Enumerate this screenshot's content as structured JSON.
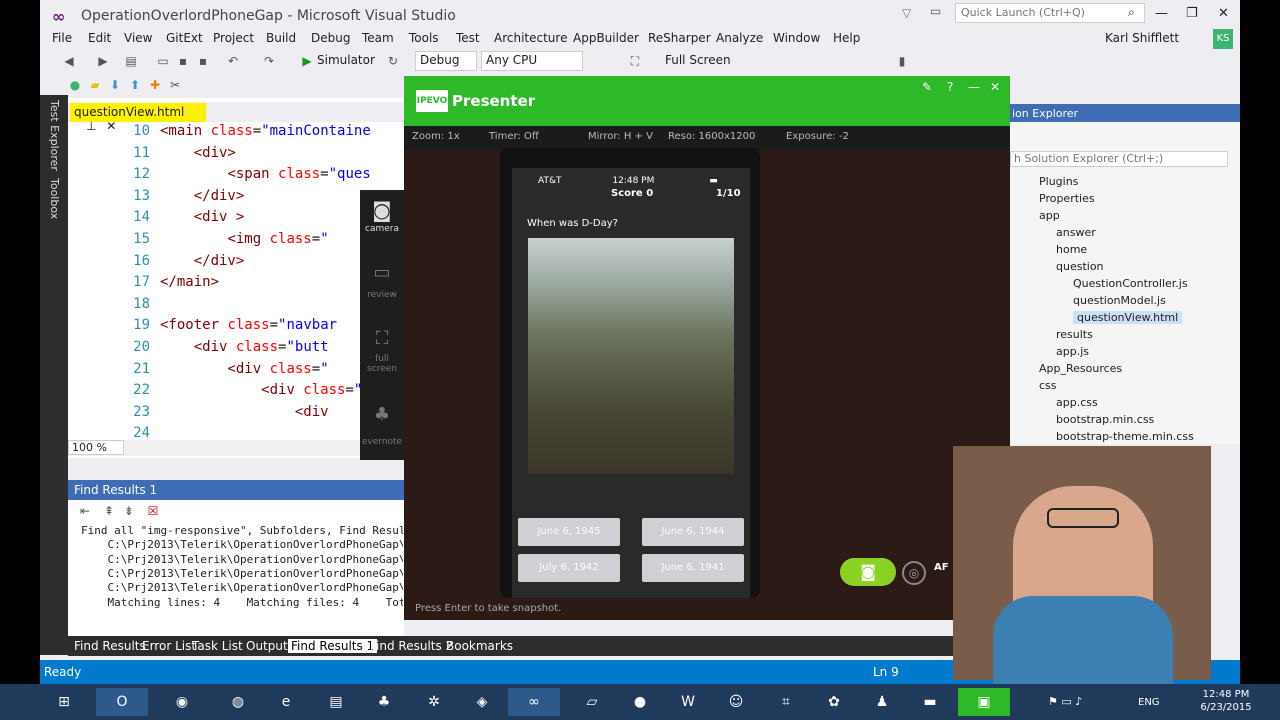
{
  "window": {
    "title": "OperationOverlordPhoneGap - Microsoft Visual Studio",
    "quick_launch": "Quick Launch (Ctrl+Q)",
    "user": "Karl Shifflett",
    "avatar": "KS"
  },
  "menu": [
    "File",
    "Edit",
    "View",
    "GitExt",
    "Project",
    "Build",
    "Debug",
    "Team",
    "Tools",
    "Test",
    "Architecture",
    "AppBuilder",
    "ReSharper",
    "Analyze",
    "Window",
    "Help"
  ],
  "toolbar": {
    "run_target": "Simulator",
    "config": "Debug",
    "platform": "Any CPU",
    "full_screen": "Full Screen"
  },
  "side_tabs": [
    "Test Explorer",
    "Toolbox"
  ],
  "editor": {
    "file_tab": "questionView.html",
    "zoom": "100 %",
    "lines": [
      {
        "n": "10",
        "html": "<span class='tag'>&lt;main</span> <span class='attr'>class</span>=<span class='str'>\"mainContaine</span>"
      },
      {
        "n": "11",
        "html": "    <span class='tag'>&lt;div&gt;</span>"
      },
      {
        "n": "12",
        "html": "        <span class='tag'>&lt;span</span> <span class='attr'>class</span>=<span class='str'>\"ques</span>"
      },
      {
        "n": "13",
        "html": "    <span class='tag'>&lt;/div&gt;</span>"
      },
      {
        "n": "14",
        "html": "    <span class='tag'>&lt;div</span> <span class='tag'>&gt;</span>"
      },
      {
        "n": "15",
        "html": "        <span class='tag'>&lt;img</span> <span class='attr'>class</span>=<span class='str'>\"</span>"
      },
      {
        "n": "16",
        "html": "    <span class='tag'>&lt;/div&gt;</span>"
      },
      {
        "n": "17",
        "html": "<span class='tag'>&lt;/main&gt;</span>"
      },
      {
        "n": "18",
        "html": ""
      },
      {
        "n": "19",
        "html": "<span class='tag'>&lt;footer</span> <span class='attr'>class</span>=<span class='str'>\"navbar</span>"
      },
      {
        "n": "20",
        "html": "    <span class='tag'>&lt;div</span> <span class='attr'>class</span>=<span class='str'>\"butt</span>"
      },
      {
        "n": "21",
        "html": "        <span class='tag'>&lt;div</span> <span class='attr'>class</span>=<span class='str'>\"</span>"
      },
      {
        "n": "22",
        "html": "            <span class='tag'>&lt;div</span> <span class='attr'>class</span>=<span class='str'>\"</span>"
      },
      {
        "n": "23",
        "html": "                <span class='tag'>&lt;div</span>"
      },
      {
        "n": "24",
        "html": ""
      }
    ]
  },
  "find_results": {
    "title": "Find Results 1",
    "lines": [
      "Find all \"img-responsive\", Subfolders, Find Resul",
      "    C:\\Prj2013\\Telerik\\OperationOverlordPhoneGap\\ap",
      "    C:\\Prj2013\\Telerik\\OperationOverlordPhoneGap\\ap",
      "    C:\\Prj2013\\Telerik\\OperationOverlordPhoneGap\\ap",
      "    C:\\Prj2013\\Telerik\\OperationOverlordPhoneGap\\cs",
      "    Matching lines: 4    Matching files: 4    Total"
    ]
  },
  "bottom_tabs": [
    "Find Results",
    "Error List",
    "Task List",
    "Output",
    "Find Results 1",
    "Find Results 2",
    "Bookmarks"
  ],
  "status": {
    "left": "Ready",
    "ln": "Ln 9"
  },
  "solution": {
    "title": "ion Explorer",
    "search": "h Solution Explorer (Ctrl+;)",
    "items": [
      "Plugins",
      "Properties",
      "app",
      "answer",
      "home",
      "question",
      "QuestionController.js",
      "questionModel.js",
      "questionView.html",
      "results",
      "app.js",
      "App_Resources",
      "css",
      "app.css",
      "bootstrap.min.css",
      "bootstrap-theme.min.css"
    ]
  },
  "presenter": {
    "logo": "IPEVO",
    "title": "Presenter",
    "options": [
      "Zoom: 1x",
      "Timer: Off",
      "Mirror: H + V",
      "Reso: 1600x1200",
      "Exposure: -2"
    ],
    "side": [
      "camera",
      "review",
      "full screen",
      "evernote"
    ],
    "footer": "Press Enter to take snapshot.",
    "af": "AF"
  },
  "phone": {
    "carrier": "AT&T",
    "time": "12:48 PM",
    "score": "Score 0",
    "count": "1/10",
    "question": "When was D-Day?",
    "answers": [
      "June 6, 1945",
      "June 6, 1944",
      "July 6, 1942",
      "June 6, 1941"
    ]
  },
  "taskbar": {
    "clock_time": "12:48 PM",
    "clock_date": "6/23/2015",
    "lang": "ENG"
  }
}
